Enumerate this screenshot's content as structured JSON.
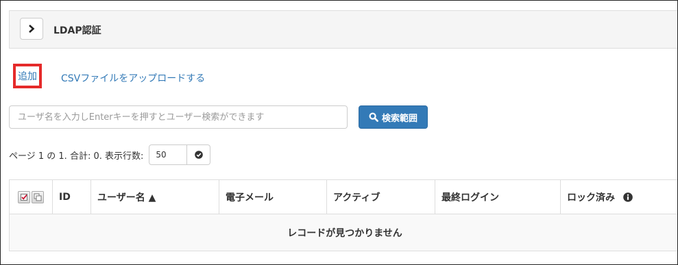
{
  "panel": {
    "title": "LDAP認証"
  },
  "actions": {
    "add_label": "追加",
    "csv_upload_label": "CSVファイルをアップロードする"
  },
  "search": {
    "placeholder": "ユーザ名を入力しEnterキーを押すとユーザー検索ができます",
    "button_label": "検索範囲"
  },
  "pager": {
    "summary": "ページ 1 の 1. 合計: 0. 表示行数:",
    "rows_per_page": "50"
  },
  "table": {
    "columns": {
      "id": "ID",
      "username": "ユーザー名 ▲",
      "email": "電子メール",
      "active": "アクティブ",
      "last_login": "最終ログイン",
      "locked": "ロック済み"
    },
    "empty_message": "レコードが見つかりません"
  },
  "icons": {
    "toggle": "chevron-right-icon",
    "search": "search-icon",
    "rows_apply": "check-circle-icon",
    "select_all": "checkbox-check-icon",
    "select_copy": "checkbox-copy-icon",
    "info": "info-circle-icon"
  },
  "colors": {
    "link": "#337ab7",
    "primary": "#337ab7",
    "highlight": "#e52a2a"
  }
}
